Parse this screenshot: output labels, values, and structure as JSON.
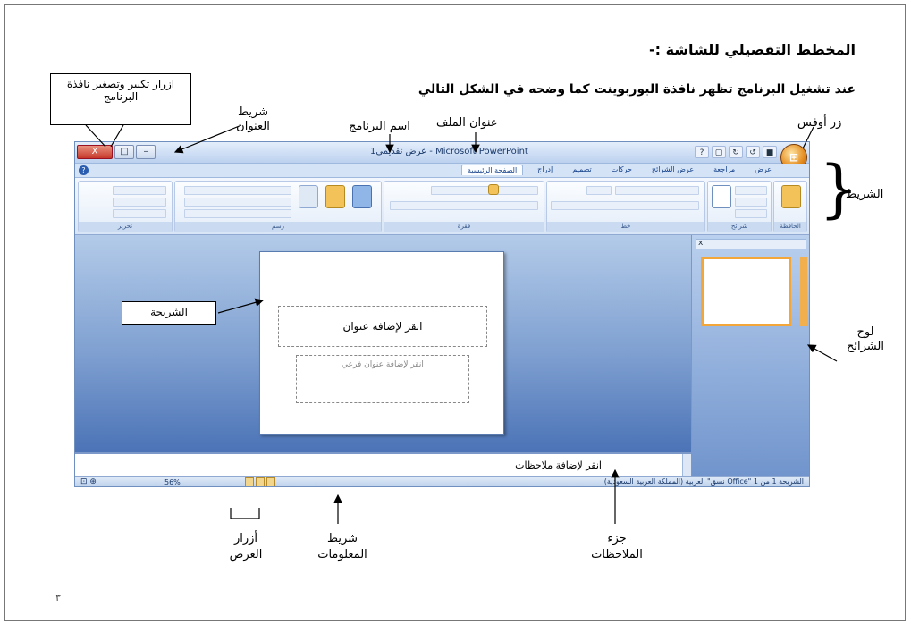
{
  "document": {
    "heading": "المخطط التفصيلي للشاشة :-",
    "subheading": "عند تشغيل البرنامج تظهر نافذة البوربوينت كما وضحه في الشكل التالي",
    "page_number": "٣"
  },
  "window": {
    "title": "عرض تقديمي1 - Microsoft PowerPoint",
    "close_label": "X",
    "ribbon_tabs": [
      "الصفحة الرئيسية",
      "إدراج",
      "تصميم",
      "حركات",
      "عرض الشرائح",
      "مراجعة",
      "عرض"
    ],
    "groups": [
      "الحافظة",
      "شرائح",
      "خط",
      "فقرة",
      "رسم",
      "تحرير"
    ],
    "title_placeholder": "انقر لإضافة عنوان",
    "subtitle_placeholder": "انقر لإضافة عنوان فرعي",
    "notes_placeholder": "انقر لإضافة ملاحظات",
    "status_text": "الشريحة 1 من 1   \"Office نسق\"   العربية (المملكة العربية السعودية)",
    "zoom": "56%"
  },
  "callouts": {
    "min_max_buttons": "ازرار تكبير وتصغير نافذة البرنامج",
    "title_bar": "شريط العنوان",
    "program_name": "اسم البرنامج",
    "file_title": "عنوان الملف",
    "office_button": "زر أوفس",
    "ribbon": "الشريط",
    "slide": "الشريحة",
    "slides_pane": "لوح الشرائح",
    "view_buttons": "أزرار العرض",
    "status_bar": "شريط المعلومات",
    "notes_pane": "جزء الملاحظات"
  }
}
